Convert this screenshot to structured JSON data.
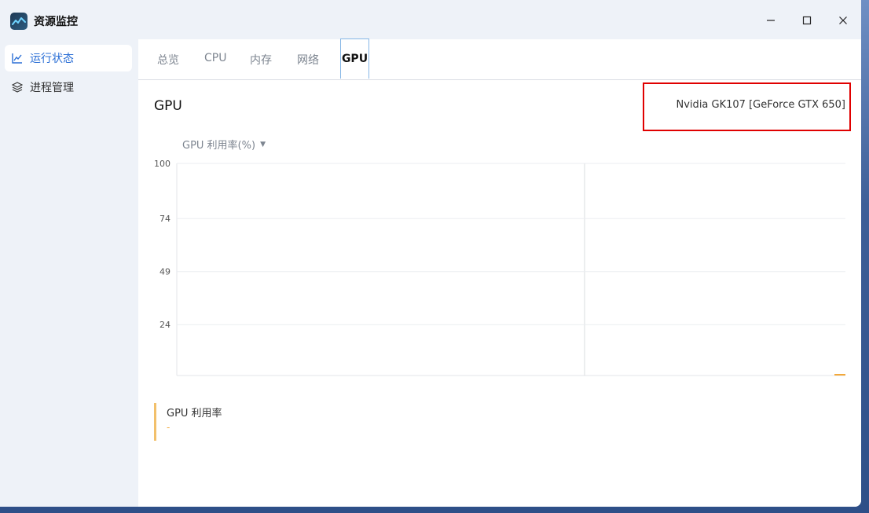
{
  "window": {
    "title": "资源监控"
  },
  "sidebar": {
    "items": [
      {
        "label": "运行状态",
        "active": true,
        "icon": "line-chart-icon"
      },
      {
        "label": "进程管理",
        "active": false,
        "icon": "layers-icon"
      }
    ]
  },
  "tabs": [
    {
      "label": "总览",
      "active": false
    },
    {
      "label": "CPU",
      "active": false
    },
    {
      "label": "内存",
      "active": false
    },
    {
      "label": "网络",
      "active": false
    },
    {
      "label": "GPU",
      "active": true
    }
  ],
  "gpu_section": {
    "title": "GPU",
    "device_name": "Nvidia GK107 [GeForce GTX 650]",
    "metric_select": "GPU 利用率(%)",
    "legend_label": "GPU 利用率",
    "legend_value": "-"
  },
  "colors": {
    "accent": "#2b6fd6",
    "series": "#f2a83a",
    "highlight": "#e00000"
  },
  "chart_data": {
    "type": "line",
    "title": "",
    "xlabel": "",
    "ylabel": "",
    "ylim": [
      0,
      100
    ],
    "yticks": [
      100,
      74,
      49,
      24
    ],
    "series": [
      {
        "name": "GPU 利用率",
        "values": [
          0
        ]
      }
    ],
    "grid": true
  }
}
